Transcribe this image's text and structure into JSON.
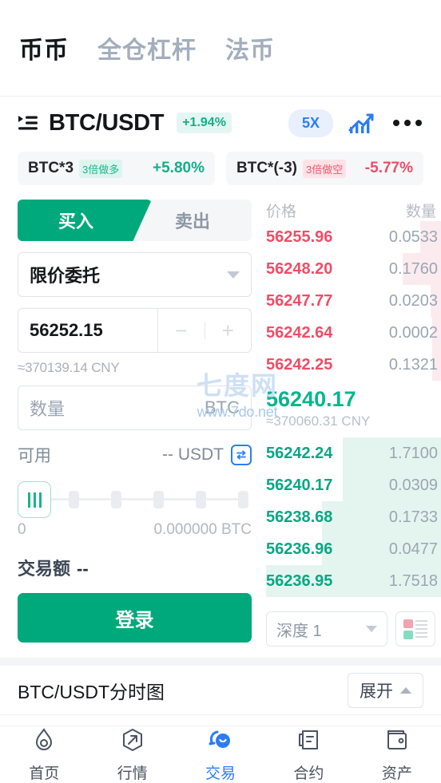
{
  "top_tabs": [
    {
      "label": "币币",
      "active": true
    },
    {
      "label": "全仓杠杆",
      "active": false
    },
    {
      "label": "法币",
      "active": false
    }
  ],
  "pair_header": {
    "list_icon": "pair-list-icon",
    "pair": "BTC/USDT",
    "change": "+1.94%",
    "leverage": "5X",
    "chart_icon": "trend-chart-icon",
    "more_icon": "more-dots-icon"
  },
  "leverage_tokens": [
    {
      "symbol": "BTC*3",
      "tag": "3倍做多",
      "pct": "+5.80%",
      "dir": "up"
    },
    {
      "symbol": "BTC*(-3)",
      "tag": "3倍做空",
      "pct": "-5.77%",
      "dir": "down"
    }
  ],
  "order_form": {
    "buy_tab": "买入",
    "sell_tab": "卖出",
    "order_type": "限价委托",
    "price_value": "56252.15",
    "minus": "−",
    "plus": "+",
    "price_approx": "≈370139.14 CNY",
    "amount_placeholder": "数量",
    "amount_unit": "BTC",
    "available_label": "可用",
    "available_value": "-- USDT",
    "transfer_icon": "transfer-icon",
    "slider_min": "0",
    "slider_max": "0.000000 BTC",
    "slider_percent": 0,
    "trade_amount_label": "交易额",
    "trade_amount_value": "--",
    "submit_label": "登录"
  },
  "order_book": {
    "col_price": "价格",
    "col_amount": "数量",
    "asks": [
      {
        "price": "56255.96",
        "amount": "0.0533",
        "depth": 12
      },
      {
        "price": "56248.20",
        "amount": "0.1760",
        "depth": 22
      },
      {
        "price": "56247.77",
        "amount": "0.0203",
        "depth": 6
      },
      {
        "price": "56242.64",
        "amount": "0.0002",
        "depth": 5
      },
      {
        "price": "56242.25",
        "amount": "0.1321",
        "depth": 5
      }
    ],
    "last_price": "56240.17",
    "last_cny": "≈370060.31 CNY",
    "bids": [
      {
        "price": "56242.24",
        "amount": "1.7100",
        "depth": 56
      },
      {
        "price": "56240.17",
        "amount": "0.0309",
        "depth": 56
      },
      {
        "price": "56238.68",
        "amount": "0.1733",
        "depth": 68
      },
      {
        "price": "56236.96",
        "amount": "0.0477",
        "depth": 68
      },
      {
        "price": "56236.95",
        "amount": "1.7518",
        "depth": 100
      }
    ],
    "depth_select": "深度 1",
    "depth_toggle_icon": "orderbook-layout-icon"
  },
  "chart_section": {
    "title": "BTC/USDT分时图",
    "expand_label": "展开",
    "expand_icon": "chevron-up-icon"
  },
  "bottom_nav": [
    {
      "label": "首页",
      "icon": "flame-icon",
      "active": false
    },
    {
      "label": "行情",
      "icon": "market-arrow-icon",
      "active": false
    },
    {
      "label": "交易",
      "icon": "trade-swap-icon",
      "active": true
    },
    {
      "label": "合约",
      "icon": "contract-doc-icon",
      "active": false
    },
    {
      "label": "资产",
      "icon": "wallet-icon",
      "active": false
    }
  ],
  "watermark": {
    "name": "七度网",
    "url": "www.7do.net"
  },
  "colors": {
    "up": "#10b089",
    "down": "#ef4d66",
    "accent_blue": "#2b7cf6",
    "primary_green": "#00a97b"
  }
}
